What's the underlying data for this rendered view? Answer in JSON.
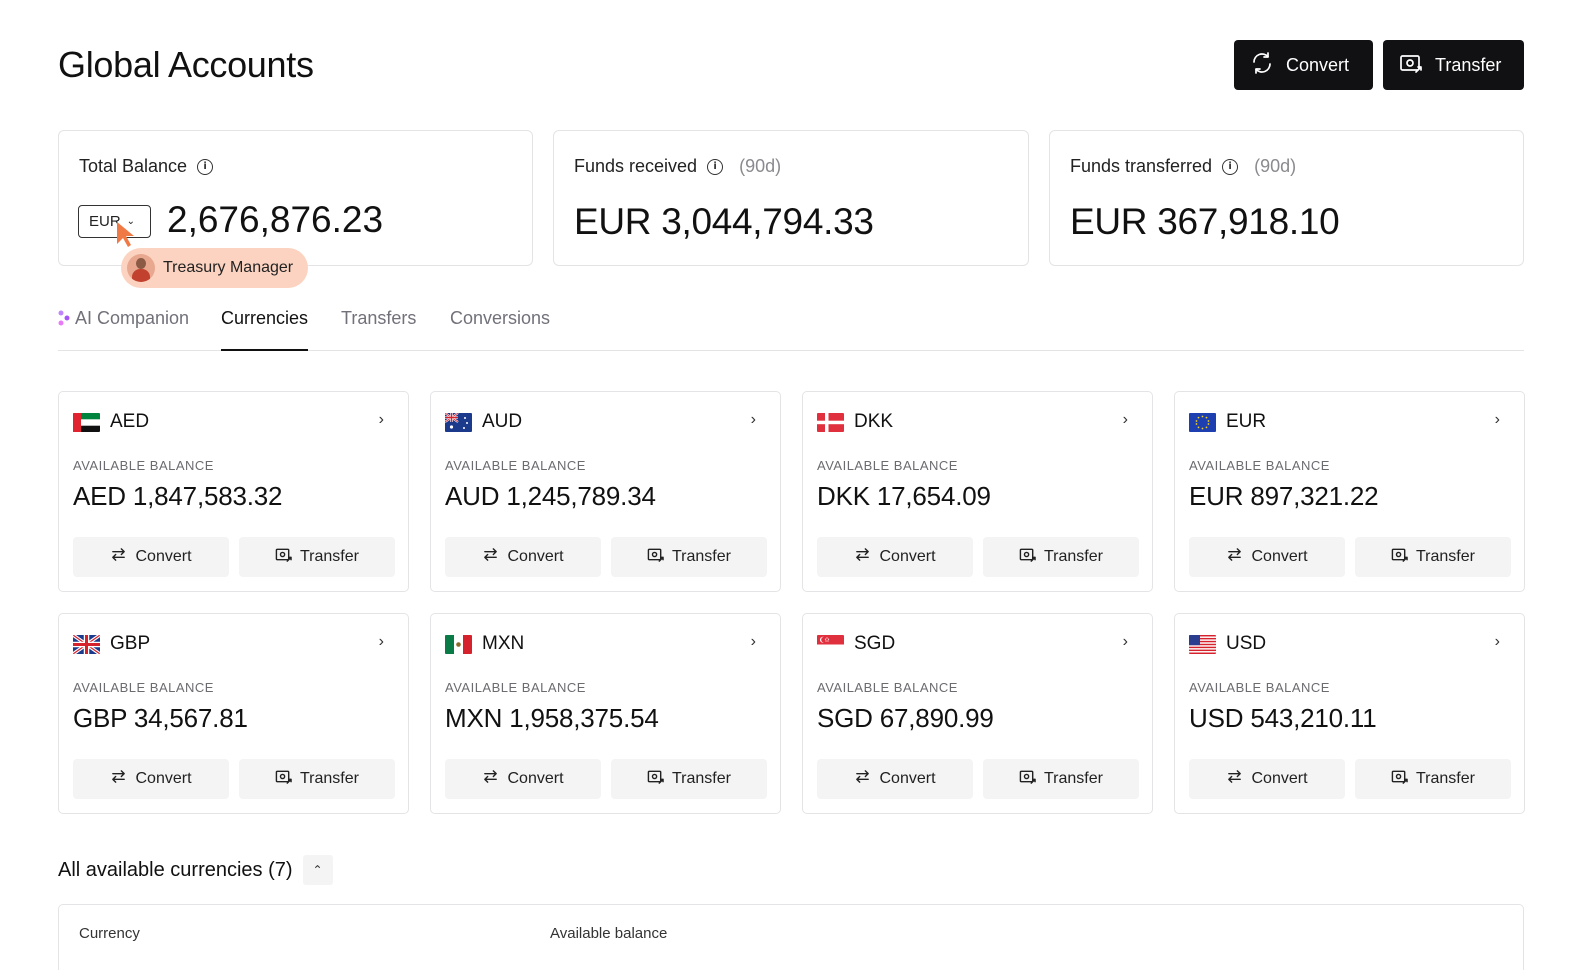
{
  "header": {
    "title": "Global Accounts",
    "convert_label": "Convert",
    "transfer_label": "Transfer"
  },
  "stats": {
    "total": {
      "label": "Total Balance",
      "currency": "EUR",
      "value": "2,676,876.23"
    },
    "received": {
      "label": "Funds received",
      "period": "(90d)",
      "value": "EUR 3,044,794.33"
    },
    "transferred": {
      "label": "Funds transferred",
      "period": "(90d)",
      "value": "EUR 367,918.10"
    }
  },
  "cursor_badge": {
    "label": "Treasury Manager",
    "color": "#fbd3c0"
  },
  "tabs": [
    {
      "label": "AI Companion"
    },
    {
      "label": "Currencies"
    },
    {
      "label": "Transfers"
    },
    {
      "label": "Conversions"
    }
  ],
  "active_tab": "Currencies",
  "currencies": [
    {
      "code": "AED",
      "flag": "ae-flag-icon",
      "available_label": "AVAILABLE BALANCE",
      "balance": "AED 1,847,583.32",
      "convert": "Convert",
      "transfer": "Transfer"
    },
    {
      "code": "AUD",
      "flag": "au-flag-icon",
      "available_label": "AVAILABLE BALANCE",
      "balance": "AUD 1,245,789.34",
      "convert": "Convert",
      "transfer": "Transfer"
    },
    {
      "code": "DKK",
      "flag": "dk-flag-icon",
      "available_label": "AVAILABLE BALANCE",
      "balance": "DKK 17,654.09",
      "convert": "Convert",
      "transfer": "Transfer"
    },
    {
      "code": "EUR",
      "flag": "eu-flag-icon",
      "available_label": "AVAILABLE BALANCE",
      "balance": "EUR 897,321.22",
      "convert": "Convert",
      "transfer": "Transfer"
    },
    {
      "code": "GBP",
      "flag": "gb-flag-icon",
      "available_label": "AVAILABLE BALANCE",
      "balance": "GBP 34,567.81",
      "convert": "Convert",
      "transfer": "Transfer"
    },
    {
      "code": "MXN",
      "flag": "mx-flag-icon",
      "available_label": "AVAILABLE BALANCE",
      "balance": "MXN 1,958,375.54",
      "convert": "Convert",
      "transfer": "Transfer"
    },
    {
      "code": "SGD",
      "flag": "sg-flag-icon",
      "available_label": "AVAILABLE BALANCE",
      "balance": "SGD 67,890.99",
      "convert": "Convert",
      "transfer": "Transfer"
    },
    {
      "code": "USD",
      "flag": "us-flag-icon",
      "available_label": "AVAILABLE BALANCE",
      "balance": "USD 543,210.11",
      "convert": "Convert",
      "transfer": "Transfer"
    }
  ],
  "all_currencies": {
    "label": "All available currencies (7)"
  },
  "table": {
    "columns": [
      "Currency",
      "Available balance"
    ]
  },
  "colors": {
    "dark_button": "#111113",
    "border": "#e4e4e7",
    "muted": "#71717a",
    "button_bg": "#f4f4f5"
  }
}
